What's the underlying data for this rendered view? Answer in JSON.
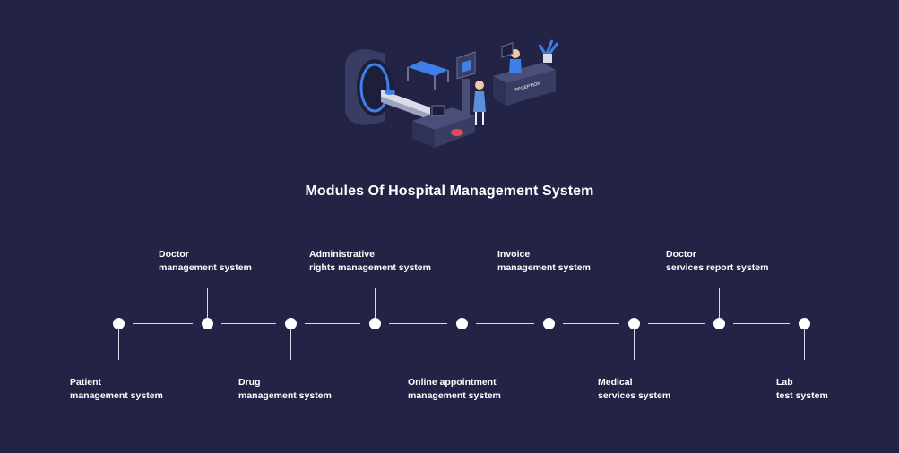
{
  "title": "Modules Of Hospital Management System",
  "modules": [
    {
      "line1": "Patient",
      "line2": "management system"
    },
    {
      "line1": "Doctor",
      "line2": "management system"
    },
    {
      "line1": "Drug",
      "line2": "management system"
    },
    {
      "line1": "Administrative",
      "line2": "rights management system"
    },
    {
      "line1": "Online appointment",
      "line2": "management system"
    },
    {
      "line1": "Invoice",
      "line2": "management system"
    },
    {
      "line1": "Medical",
      "line2": "services system"
    },
    {
      "line1": "Doctor",
      "line2": "services report system"
    },
    {
      "line1": "Lab",
      "line2": "test system"
    }
  ],
  "illustration": {
    "desk_sign": "RECEPTION"
  },
  "colors": {
    "background": "#232346",
    "accent_blue": "#3f7fe8",
    "line": "#d9d9e6"
  }
}
